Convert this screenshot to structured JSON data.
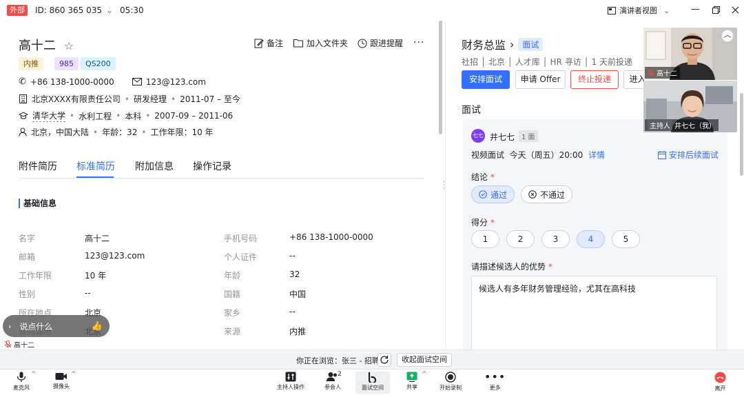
{
  "topbar": {
    "org_badge": "外部",
    "meeting_id": "ID: 860 365 035",
    "time": "05:30",
    "view_mode": "演讲者视图"
  },
  "candidate": {
    "name": "高十二",
    "actions": {
      "note": "备注",
      "folder": "加入文件夹",
      "remind": "跟进提醒"
    },
    "tags": [
      {
        "label": "内推",
        "bg": "#fdf1d6",
        "fg": "#7a5b14"
      },
      {
        "label": "985",
        "bg": "#ece2fe",
        "fg": "#4f2c92"
      },
      {
        "label": "QS200",
        "bg": "#d9f3fd",
        "fg": "#1c5775"
      }
    ],
    "phone": "+86 138-1000-0000",
    "email": "123@123.com",
    "company": "北京XXXX有限责任公司",
    "position": "研发经理",
    "work_period": "2011-07 – 至今",
    "school": "清华大学",
    "major": "水利工程",
    "degree": "本科",
    "edu_period": "2007-09 – 2011-06",
    "location": "北京，中国大陆",
    "age_text": "年龄：32",
    "years_text": "工作年限：10 年"
  },
  "tabs": [
    "附件简历",
    "标准简历",
    "附加信息",
    "操作记录"
  ],
  "basic_info": {
    "title": "基础信息",
    "left": [
      {
        "label": "名字",
        "value": "高十二"
      },
      {
        "label": "邮箱",
        "value": "123@123.com"
      },
      {
        "label": "工作年限",
        "value": "10 年"
      },
      {
        "label": "性别",
        "value": "--"
      },
      {
        "label": "所在地点",
        "value": "北京"
      },
      {
        "label": "意向城市",
        "value": "北京"
      }
    ],
    "right": [
      {
        "label": "手机号码",
        "value": "+86 138-1000-0000"
      },
      {
        "label": "个人证件",
        "value": "--"
      },
      {
        "label": "年龄",
        "value": "32"
      },
      {
        "label": "国籍",
        "value": "中国"
      },
      {
        "label": "家乡",
        "value": "--"
      },
      {
        "label": "来源",
        "value": "内推"
      }
    ]
  },
  "chat": {
    "placeholder": "说点什么",
    "self_name": "高十二"
  },
  "job": {
    "title": "财务总监",
    "stage": "面试",
    "subtitle": "社招 │ 北京 │ 人才库 │ HR 寻访 │ 1 天前投递",
    "buttons": {
      "arrange": "安排面试",
      "offer": "申请 Offer",
      "stop": "终止投递",
      "more": "进入"
    }
  },
  "interview": {
    "section": "面试",
    "interviewer_avatar": "七七",
    "interviewer": "井七七",
    "round": "1 面",
    "type_time": "视频面试  今天（周五）20:00",
    "detail_link": "详情",
    "next_link": "安排后续面试",
    "conclusion_label": "结论",
    "pass": "通过",
    "fail": "不通过",
    "score_label": "得分",
    "scores": [
      "1",
      "2",
      "3",
      "4",
      "5"
    ],
    "score_selected": 4,
    "strength_label": "请描述候选人的优势",
    "strength_text": "候选人有多年财务管理经验，尤其在高科技"
  },
  "video": {
    "tile1_name": "高十二",
    "tile2_host": "主持人",
    "tile2_name": "井七七（我）"
  },
  "browse": {
    "text": "你正在浏览：张三 - 招聘",
    "collapse": "收起面试空间"
  },
  "toolbar": {
    "mic": "麦克风",
    "camera": "摄像头",
    "host_ops": "主持人操作",
    "participants": "参会人",
    "participants_count": "2",
    "space": "面试空间",
    "share": "共享",
    "record": "开始录制",
    "more": "更多",
    "leave": "离开"
  }
}
